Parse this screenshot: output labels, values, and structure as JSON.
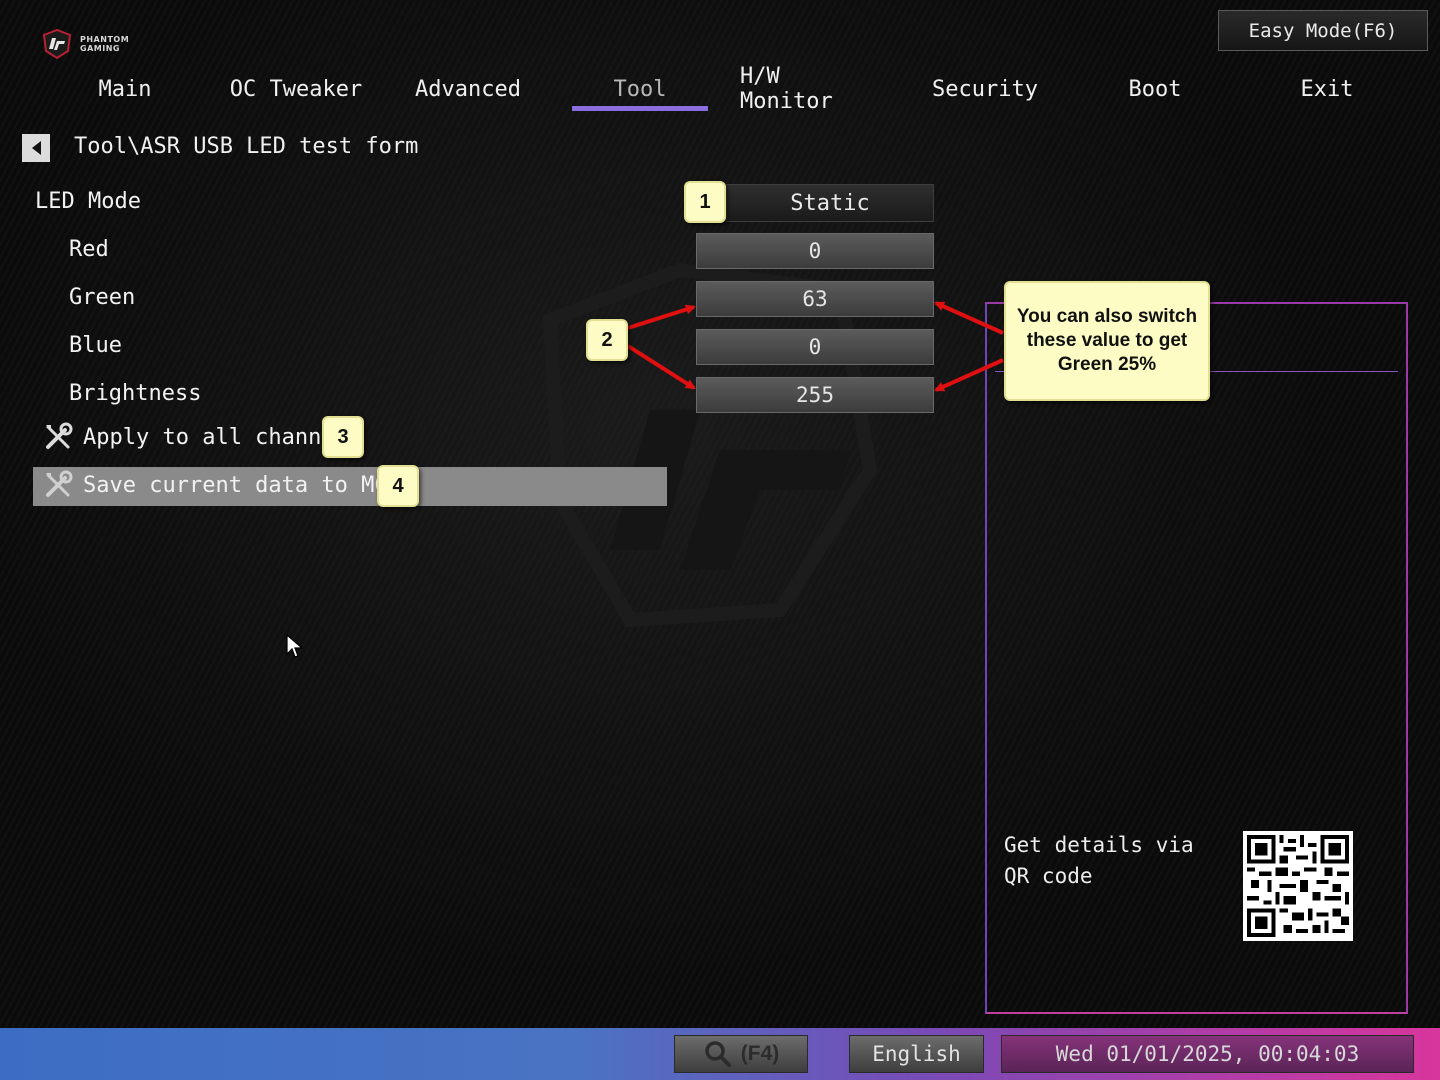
{
  "header": {
    "brand_line1": "PHANTOM",
    "brand_line2": "GAMING",
    "easy_mode_label": "Easy Mode(F6)"
  },
  "tabs": [
    {
      "label": "Main"
    },
    {
      "label": "OC Tweaker"
    },
    {
      "label": "Advanced"
    },
    {
      "label": "Tool",
      "active": true
    },
    {
      "label": "H/W Monitor"
    },
    {
      "label": "Security"
    },
    {
      "label": "Boot"
    },
    {
      "label": "Exit"
    }
  ],
  "breadcrumb": "Tool\\ASR USB LED test form",
  "settings": {
    "led_mode": {
      "label": "LED Mode",
      "value": "Static"
    },
    "red": {
      "label": "Red",
      "value": "0"
    },
    "green": {
      "label": "Green",
      "value": "63"
    },
    "blue": {
      "label": "Blue",
      "value": "0"
    },
    "brightness": {
      "label": "Brightness",
      "value": "255"
    }
  },
  "actions": {
    "apply_all": "Apply to all channel",
    "save_mcu": "Save current data to MCU"
  },
  "callouts": {
    "n1": "1",
    "n2": "2",
    "n3": "3",
    "n4": "4",
    "note": "You can also switch these value to get Green 25%"
  },
  "help_panel": {
    "qr_text": "Get details via QR code"
  },
  "bottom_bar": {
    "search_label": "(F4)",
    "language": "English",
    "datetime": "Wed 01/01/2025, 00:04:03"
  },
  "colors": {
    "tab_underline": "#8a6ee0",
    "panel_border": "#9a3aa6",
    "callout_bg": "#fdfcc4",
    "arrow": "#e01010"
  }
}
